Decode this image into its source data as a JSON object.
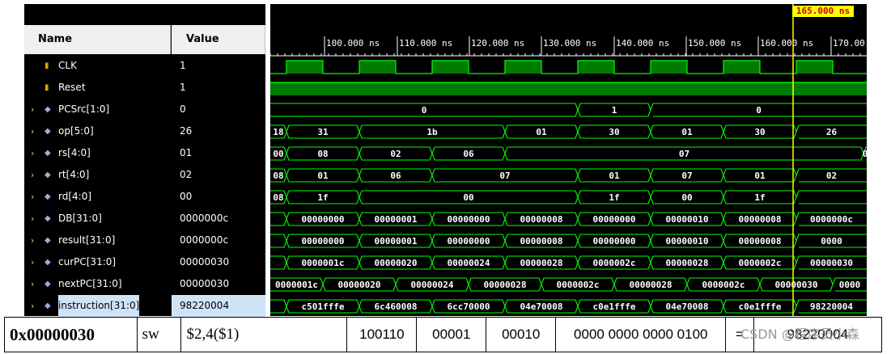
{
  "columns": {
    "name": "Name",
    "value": "Value"
  },
  "cursor": {
    "label": "165.000 ns"
  },
  "time_ruler": [
    "100.000 ns",
    "110.000 ns",
    "120.000 ns",
    "130.000 ns",
    "140.000 ns",
    "150.000 ns",
    "160.000 ns",
    "170.00"
  ],
  "signals": [
    {
      "name": "CLK",
      "value": "1",
      "kind": "bit",
      "expandable": false
    },
    {
      "name": "Reset",
      "value": "1",
      "kind": "bit",
      "expandable": false
    },
    {
      "name": "PCSrc[1:0]",
      "value": "0",
      "kind": "bus",
      "expandable": true
    },
    {
      "name": "op[5:0]",
      "value": "26",
      "kind": "bus",
      "expandable": true
    },
    {
      "name": "rs[4:0]",
      "value": "01",
      "kind": "bus",
      "expandable": true
    },
    {
      "name": "rt[4:0]",
      "value": "02",
      "kind": "bus",
      "expandable": true
    },
    {
      "name": "rd[4:0]",
      "value": "00",
      "kind": "bus",
      "expandable": true
    },
    {
      "name": "DB[31:0]",
      "value": "0000000c",
      "kind": "bus",
      "expandable": true
    },
    {
      "name": "result[31:0]",
      "value": "0000000c",
      "kind": "bus",
      "expandable": true
    },
    {
      "name": "curPC[31:0]",
      "value": "00000030",
      "kind": "bus",
      "expandable": true
    },
    {
      "name": "nextPC[31:0]",
      "value": "00000030",
      "kind": "bus",
      "expandable": true
    },
    {
      "name": "instruction[31:0]",
      "value": "98220004",
      "kind": "bus",
      "expandable": true,
      "selected": true
    }
  ],
  "bus_waves": [
    [
      {
        "t": 0,
        "v": "0"
      },
      {
        "t": 380,
        "v": "1"
      },
      {
        "t": 470,
        "v": "0"
      }
    ],
    [
      {
        "t": 0,
        "v": "18"
      },
      {
        "t": 20,
        "v": "31"
      },
      {
        "t": 110,
        "v": "1b"
      },
      {
        "t": 290,
        "v": "01"
      },
      {
        "t": 380,
        "v": "30"
      },
      {
        "t": 470,
        "v": "01"
      },
      {
        "t": 560,
        "v": "30"
      },
      {
        "t": 650,
        "v": "26"
      }
    ],
    [
      {
        "t": 0,
        "v": "00"
      },
      {
        "t": 20,
        "v": "08"
      },
      {
        "t": 110,
        "v": "02"
      },
      {
        "t": 200,
        "v": "06"
      },
      {
        "t": 290,
        "v": "07"
      },
      {
        "t": 733,
        "v": "0"
      }
    ],
    [
      {
        "t": 0,
        "v": "08"
      },
      {
        "t": 20,
        "v": "01"
      },
      {
        "t": 110,
        "v": "06"
      },
      {
        "t": 200,
        "v": "07"
      },
      {
        "t": 380,
        "v": "01"
      },
      {
        "t": 470,
        "v": "07"
      },
      {
        "t": 560,
        "v": "01"
      },
      {
        "t": 650,
        "v": "02"
      }
    ],
    [
      {
        "t": 0,
        "v": "08"
      },
      {
        "t": 20,
        "v": "1f"
      },
      {
        "t": 110,
        "v": "00"
      },
      {
        "t": 380,
        "v": "1f"
      },
      {
        "t": 470,
        "v": "00"
      },
      {
        "t": 560,
        "v": "1f"
      },
      {
        "t": 650,
        "v": ""
      }
    ],
    [
      {
        "t": 0,
        "v": ""
      },
      {
        "t": 20,
        "v": "00000000"
      },
      {
        "t": 110,
        "v": "00000001"
      },
      {
        "t": 200,
        "v": "00000000"
      },
      {
        "t": 290,
        "v": "00000008"
      },
      {
        "t": 380,
        "v": "00000000"
      },
      {
        "t": 470,
        "v": "00000010"
      },
      {
        "t": 560,
        "v": "00000008"
      },
      {
        "t": 650,
        "v": "0000000c"
      }
    ],
    [
      {
        "t": 0,
        "v": ""
      },
      {
        "t": 20,
        "v": "00000000"
      },
      {
        "t": 110,
        "v": "00000001"
      },
      {
        "t": 200,
        "v": "00000000"
      },
      {
        "t": 290,
        "v": "00000008"
      },
      {
        "t": 380,
        "v": "00000000"
      },
      {
        "t": 470,
        "v": "00000010"
      },
      {
        "t": 560,
        "v": "00000008"
      },
      {
        "t": 650,
        "v": "0000"
      }
    ],
    [
      {
        "t": 0,
        "v": ""
      },
      {
        "t": 20,
        "v": "0000001c"
      },
      {
        "t": 110,
        "v": "00000020"
      },
      {
        "t": 200,
        "v": "00000024"
      },
      {
        "t": 290,
        "v": "00000028"
      },
      {
        "t": 380,
        "v": "0000002c"
      },
      {
        "t": 470,
        "v": "00000028"
      },
      {
        "t": 560,
        "v": "0000002c"
      },
      {
        "t": 650,
        "v": "00000030"
      }
    ],
    [
      {
        "t": 0,
        "v": "0000001c"
      },
      {
        "t": 65,
        "v": "00000020"
      },
      {
        "t": 155,
        "v": "00000024"
      },
      {
        "t": 245,
        "v": "00000028"
      },
      {
        "t": 335,
        "v": "0000002c"
      },
      {
        "t": 425,
        "v": "00000028"
      },
      {
        "t": 515,
        "v": "0000002c"
      },
      {
        "t": 605,
        "v": "00000030"
      },
      {
        "t": 695,
        "v": "0000"
      }
    ],
    [
      {
        "t": 0,
        "v": ""
      },
      {
        "t": 20,
        "v": "c501fffe"
      },
      {
        "t": 110,
        "v": "6c460008"
      },
      {
        "t": 200,
        "v": "6cc70000"
      },
      {
        "t": 290,
        "v": "04e70008"
      },
      {
        "t": 380,
        "v": "c0e1fffe"
      },
      {
        "t": 470,
        "v": "04e70008"
      },
      {
        "t": 560,
        "v": "c0e1fffe"
      },
      {
        "t": 650,
        "v": "98220004"
      }
    ]
  ],
  "bottom_row": {
    "address": "0x00000030",
    "mnemonic": "sw",
    "operands": "$2,4($1)",
    "op_bits": "100110",
    "rs_bits": "00001",
    "rt_bits": "00010",
    "imm_bits": "0000 0000 0000 0100",
    "equals": "=",
    "hex": "98220004"
  },
  "watermark": "CSDN @程序员小森",
  "colors": {
    "wave": "#00ff00",
    "cursor": "#ffff00",
    "background": "#000000"
  }
}
